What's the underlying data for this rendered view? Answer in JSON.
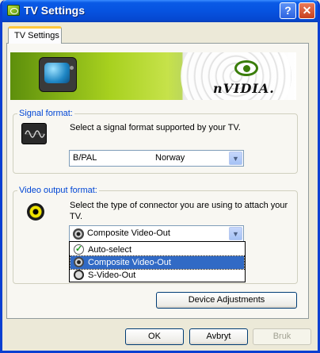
{
  "window": {
    "title": "TV Settings"
  },
  "tabs": [
    {
      "label": "TV Settings"
    }
  ],
  "banner": {
    "brand": "nVIDIA."
  },
  "signal_format": {
    "legend": "Signal format:",
    "description": "Select a signal format supported by your TV.",
    "format_value": "B/PAL",
    "country_value": "Norway",
    "icon": "signal-wave-icon"
  },
  "video_output": {
    "legend": "Video output format:",
    "description": "Select the type of connector you are using to attach your TV.",
    "selected": "Composite Video-Out",
    "icon": "rca-connector-icon",
    "options": [
      {
        "label": "Auto-select",
        "icon": "auto-check-icon"
      },
      {
        "label": "Composite Video-Out",
        "icon": "composite-connector-icon",
        "selected": true
      },
      {
        "label": "S-Video-Out",
        "icon": "svideo-connector-icon"
      }
    ]
  },
  "buttons": {
    "device_adjustments": "Device Adjustments",
    "ok": "OK",
    "cancel": "Avbryt",
    "apply": "Bruk"
  },
  "titlebar_buttons": {
    "help": "?",
    "close": "✕"
  },
  "colors": {
    "title_blue": "#0653e0",
    "selection": "#316ac5",
    "legend_blue": "#0046d5",
    "nvidia_green": "#76b900"
  }
}
